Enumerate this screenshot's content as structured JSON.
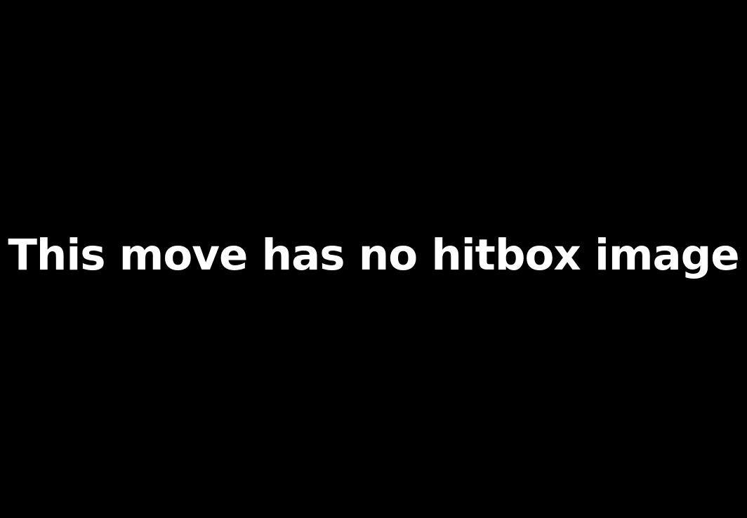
{
  "message": "This move has no hitbox image",
  "colors": {
    "background": "#000000",
    "text": "#ffffff"
  }
}
